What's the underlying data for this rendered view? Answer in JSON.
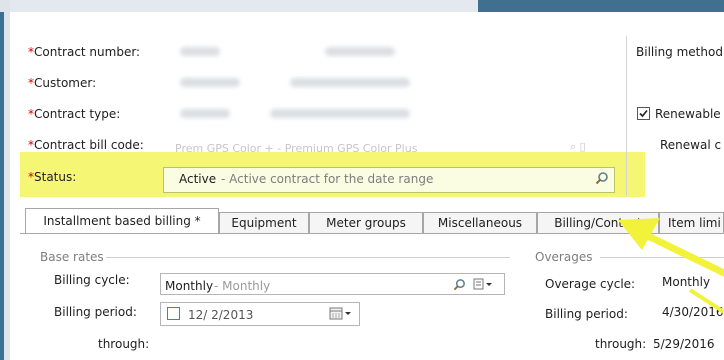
{
  "form": {
    "labels": {
      "contract_number": "Contract number:",
      "customer": "Customer:",
      "contract_type": "Contract type:",
      "contract_bill_code": "Contract bill code:",
      "status": "Status:"
    },
    "required_mark": "*",
    "bill_code_value": "Prem GPS Color + - Premium GPS Color Plus",
    "status_value": "Active",
    "status_desc": " - Active contract for the date range"
  },
  "right": {
    "billing_method_label": "Billing method",
    "renewable_label": "Renewable",
    "renewal_label": "Renewal c"
  },
  "tabs": [
    {
      "label": "Installment based billing *"
    },
    {
      "label": "Equipment"
    },
    {
      "label": "Meter groups"
    },
    {
      "label": "Miscellaneous"
    },
    {
      "label": "Billing/Contact"
    },
    {
      "label": "Item limi"
    }
  ],
  "base_rates": {
    "section": "Base rates",
    "billing_cycle_label": "Billing cycle:",
    "billing_cycle_value": "Monthly",
    "billing_cycle_desc": " - Monthly",
    "billing_period_label": "Billing period:",
    "billing_period_value": "12/ 2/2013",
    "through_label": "through:"
  },
  "overages": {
    "section": "Overages",
    "overage_cycle_label": "Overage cycle:",
    "overage_cycle_value": "Monthly",
    "billing_period_label": "Billing period:",
    "billing_period_value": "4/30/2016",
    "through_label": "through:",
    "through_value": "5/29/2016"
  },
  "colors": {
    "highlight": "#f3f55a",
    "arrow": "#f2f23a",
    "required": "#d20000",
    "accent_bar": "#41708f"
  }
}
